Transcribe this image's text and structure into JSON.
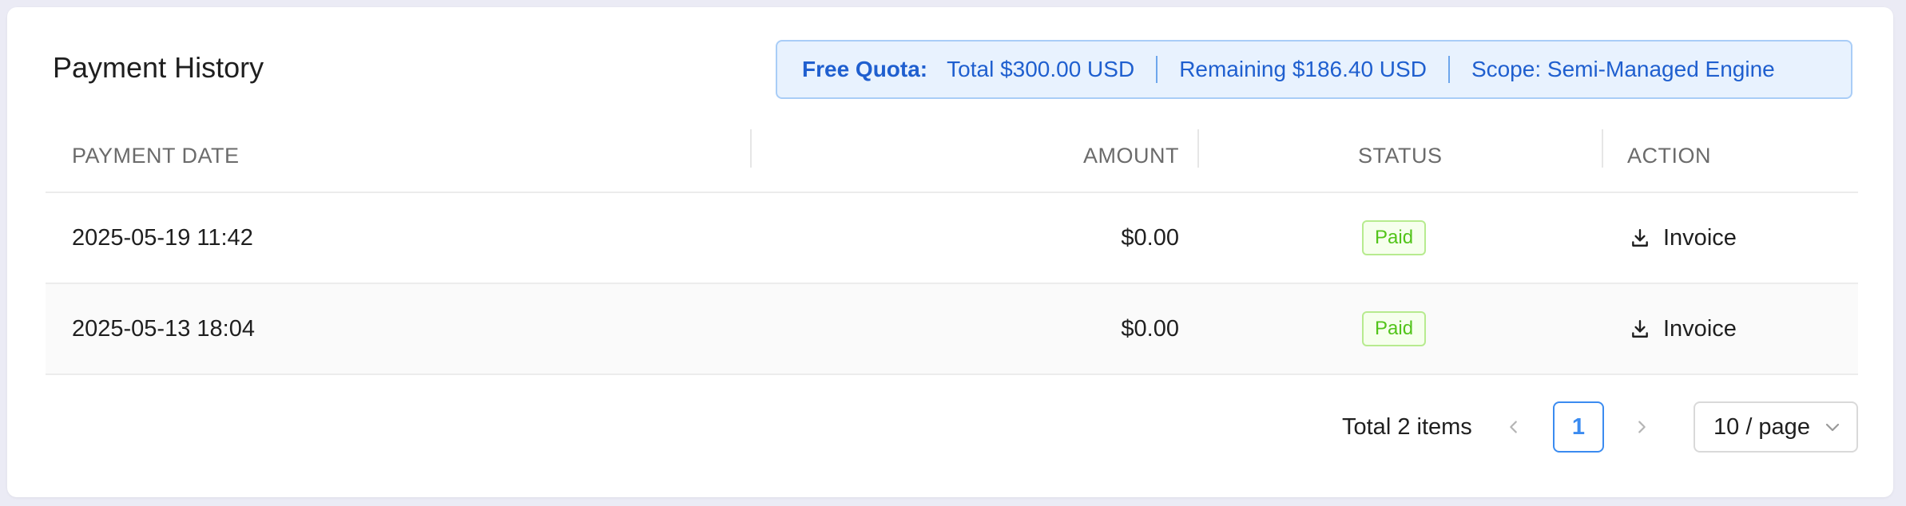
{
  "page": {
    "title": "Payment History"
  },
  "quota": {
    "label": "Free Quota:",
    "total": "Total $300.00 USD",
    "remaining": "Remaining $186.40 USD",
    "scope": "Scope: Semi-Managed Engine"
  },
  "table": {
    "headers": {
      "date": "PAYMENT DATE",
      "amount": "AMOUNT",
      "status": "STATUS",
      "action": "ACTION"
    },
    "rows": [
      {
        "date": "2025-05-19 11:42",
        "amount": "$0.00",
        "status": "Paid",
        "action": "Invoice"
      },
      {
        "date": "2025-05-13 18:04",
        "amount": "$0.00",
        "status": "Paid",
        "action": "Invoice"
      }
    ]
  },
  "pagination": {
    "total": "Total 2 items",
    "current_page": "1",
    "page_size": "10 / page"
  },
  "colors": {
    "accent": "#3b8bf0",
    "status_paid": "#52c41a",
    "quota_text": "#1f5fcf"
  },
  "icons": {
    "download": "download-icon",
    "prev": "chevron-left-icon",
    "next": "chevron-right-icon",
    "dropdown": "chevron-down-icon"
  }
}
